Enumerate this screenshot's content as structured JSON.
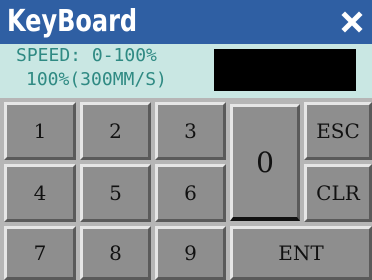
{
  "window": {
    "title": "KeyBoard",
    "close_icon": "close-icon"
  },
  "info": {
    "line1": "SPEED: 0-100%",
    "line2": "100%(300MM/S)",
    "display_value": ""
  },
  "keypad": {
    "keys": {
      "k1": "1",
      "k2": "2",
      "k3": "3",
      "k4": "4",
      "k5": "5",
      "k6": "6",
      "k7": "7",
      "k8": "8",
      "k9": "9",
      "k0": "0",
      "esc": "ESC",
      "clr": "CLR",
      "ent": "ENT"
    }
  },
  "colors": {
    "title_bar": "#2f5fa3",
    "info_background": "#c9e7e3",
    "info_text": "#2f8a83",
    "key_face": "#8e8e8e",
    "display_background": "#000000"
  }
}
